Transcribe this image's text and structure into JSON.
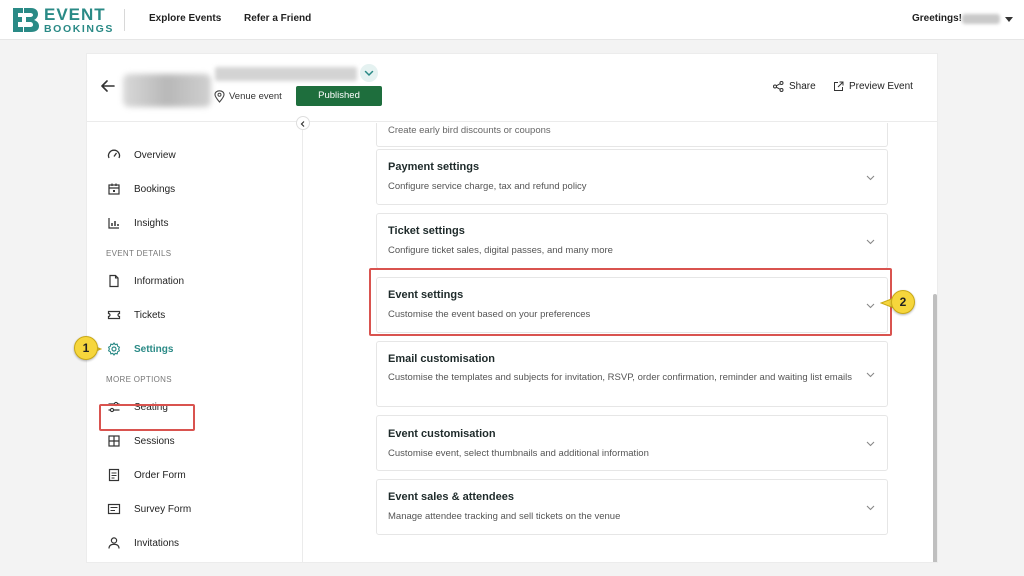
{
  "brand": {
    "line1": "EVENT",
    "line2": "BOOKINGS",
    "color": "#2a8a86"
  },
  "nav": {
    "explore": "Explore Events",
    "refer": "Refer a Friend",
    "greeting": "Greetings!"
  },
  "event": {
    "venue": "Venue event",
    "status": "Published",
    "share": "Share",
    "preview": "Preview Event"
  },
  "sidebar": {
    "items_top": [
      "Overview",
      "Bookings",
      "Insights"
    ],
    "section_details": "EVENT DETAILS",
    "items_details": [
      "Information",
      "Tickets",
      "Settings"
    ],
    "section_more": "MORE OPTIONS",
    "items_more": [
      "Seating",
      "Sessions",
      "Order Form",
      "Survey Form",
      "Invitations"
    ],
    "active": "Settings"
  },
  "settings": {
    "cutoff_text": "Create early bird discounts or coupons",
    "panels": [
      {
        "title": "Payment settings",
        "desc": "Configure service charge, tax and refund policy"
      },
      {
        "title": "Ticket settings",
        "desc": "Configure ticket sales, digital passes, and many more"
      },
      {
        "title": "Event settings",
        "desc": "Customise the event based on your preferences"
      },
      {
        "title": "Email customisation",
        "desc": "Customise the templates and subjects for invitation, RSVP, order confirmation, reminder and waiting list emails"
      },
      {
        "title": "Event customisation",
        "desc": "Customise event, select thumbnails and additional information"
      },
      {
        "title": "Event sales & attendees",
        "desc": "Manage attendee tracking and sell tickets on the venue"
      }
    ]
  },
  "callouts": {
    "one": "1",
    "two": "2"
  },
  "colors": {
    "accent": "#2a8a86",
    "published": "#1e6e3d",
    "highlight": "#d9534f",
    "badge": "#f6d63c"
  }
}
